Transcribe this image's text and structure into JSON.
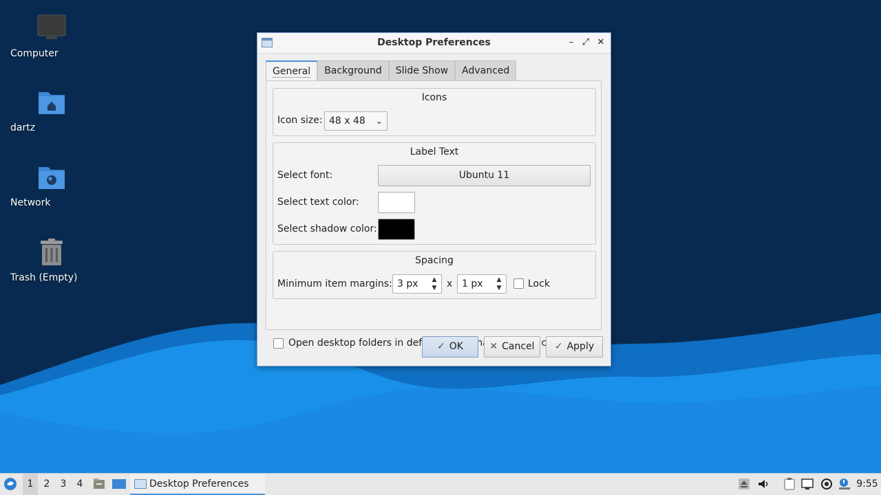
{
  "desktop": {
    "icons": [
      {
        "name": "computer",
        "label": "Computer"
      },
      {
        "name": "home-folder",
        "label": "dartz"
      },
      {
        "name": "network",
        "label": "Network"
      },
      {
        "name": "trash",
        "label": "Trash (Empty)"
      }
    ]
  },
  "window": {
    "title": "Desktop Preferences",
    "controls": {
      "minimize": "–",
      "maximize": "⤢",
      "close": "✕"
    },
    "tabs": [
      "General",
      "Background",
      "Slide Show",
      "Advanced"
    ],
    "active_tab": "General",
    "icons_group": {
      "title": "Icons",
      "icon_size_label": "Icon size:",
      "icon_size_value": "48 x 48"
    },
    "label_text_group": {
      "title": "Label Text",
      "font_label": "Select font:",
      "font_value": "Ubuntu 11",
      "text_color_label": "Select text color:",
      "text_color": "#ffffff",
      "shadow_color_label": "Select shadow color:",
      "shadow_color": "#000000"
    },
    "spacing_group": {
      "title": "Spacing",
      "margins_label": "Minimum item margins:",
      "margin_x": "3 px",
      "separator": "x",
      "margin_y": "1 px",
      "lock_label": "Lock",
      "lock_checked": false
    },
    "open_folders_label": "Open desktop folders in default file manager by left clicking",
    "open_folders_checked": false,
    "buttons": {
      "ok": "OK",
      "cancel": "Cancel",
      "apply": "Apply"
    }
  },
  "taskbar": {
    "workspaces": [
      "1",
      "2",
      "3",
      "4"
    ],
    "active_workspace": "1",
    "task_title": "Desktop Preferences",
    "clock": "9:55"
  },
  "colors": {
    "accent": "#4a90d9",
    "desktop_dark": "#0b2c52",
    "wave_light": "#1b8fe6"
  }
}
